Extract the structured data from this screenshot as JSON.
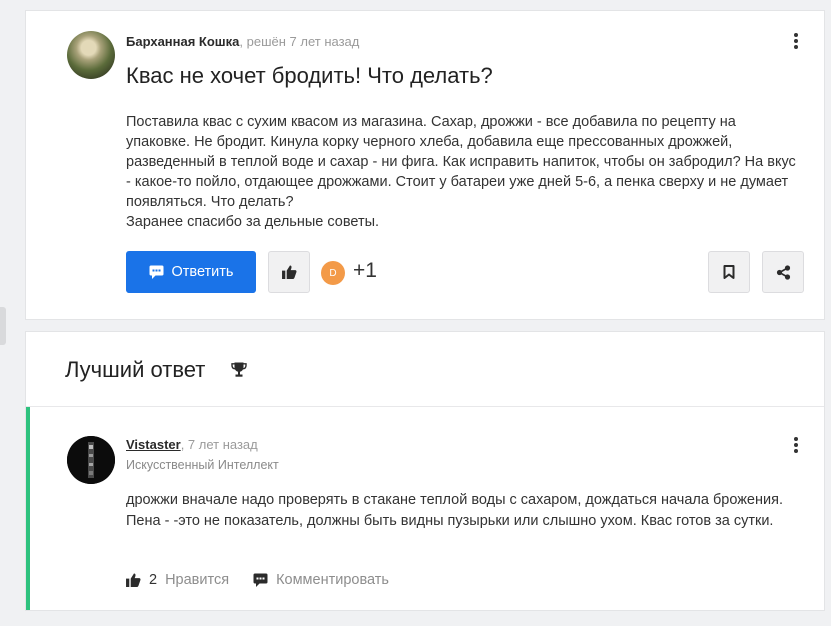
{
  "question": {
    "author": "Барханная Кошка",
    "meta_suffix": ", решён 7 лет назад",
    "title": "Квас не хочет бродить! Что делать?",
    "body": "Поставила квас с сухим квасом из магазина. Сахар, дрожжи - все добавила по рецепту на упаковке. Не бродит. Кинула корку черного хлеба, добавила еще прессованных дрожжей, разведенный в теплой воде и сахар - ни фига. Как исправить напиток, чтобы он забродил? На вкус - какое-то пойло, отдающее дрожжами. Стоит у батареи уже дней 5-6, а пенка сверху и не думает появляться. Что делать?\nЗаранее спасибо за дельные советы.",
    "answer_button": "Ответить",
    "liker_initial": "D",
    "like_count": "+1"
  },
  "best_answer": {
    "section_title": "Лучший ответ",
    "author": "Vistaster",
    "meta_suffix": ", 7 лет назад",
    "rank": "Искусственный Интеллект",
    "body": "дрожжи вначале надо проверять в стакане теплой воды с сахаром, дождаться начала брожения. Пена - -это не показатель, должны быть видны пузырьки или слышно ухом. Квас готов за сутки.",
    "likes": "2",
    "like_label": "Нравится",
    "comment_label": "Комментировать"
  },
  "colors": {
    "primary_blue": "#1a73e8",
    "best_answer_accent": "#2ec27e",
    "liker_badge": "#f39a48"
  },
  "icons": [
    "kebab-menu-icon",
    "comment-icon",
    "thumbs-up-icon",
    "bookmark-icon",
    "share-icon",
    "trophy-icon"
  ]
}
